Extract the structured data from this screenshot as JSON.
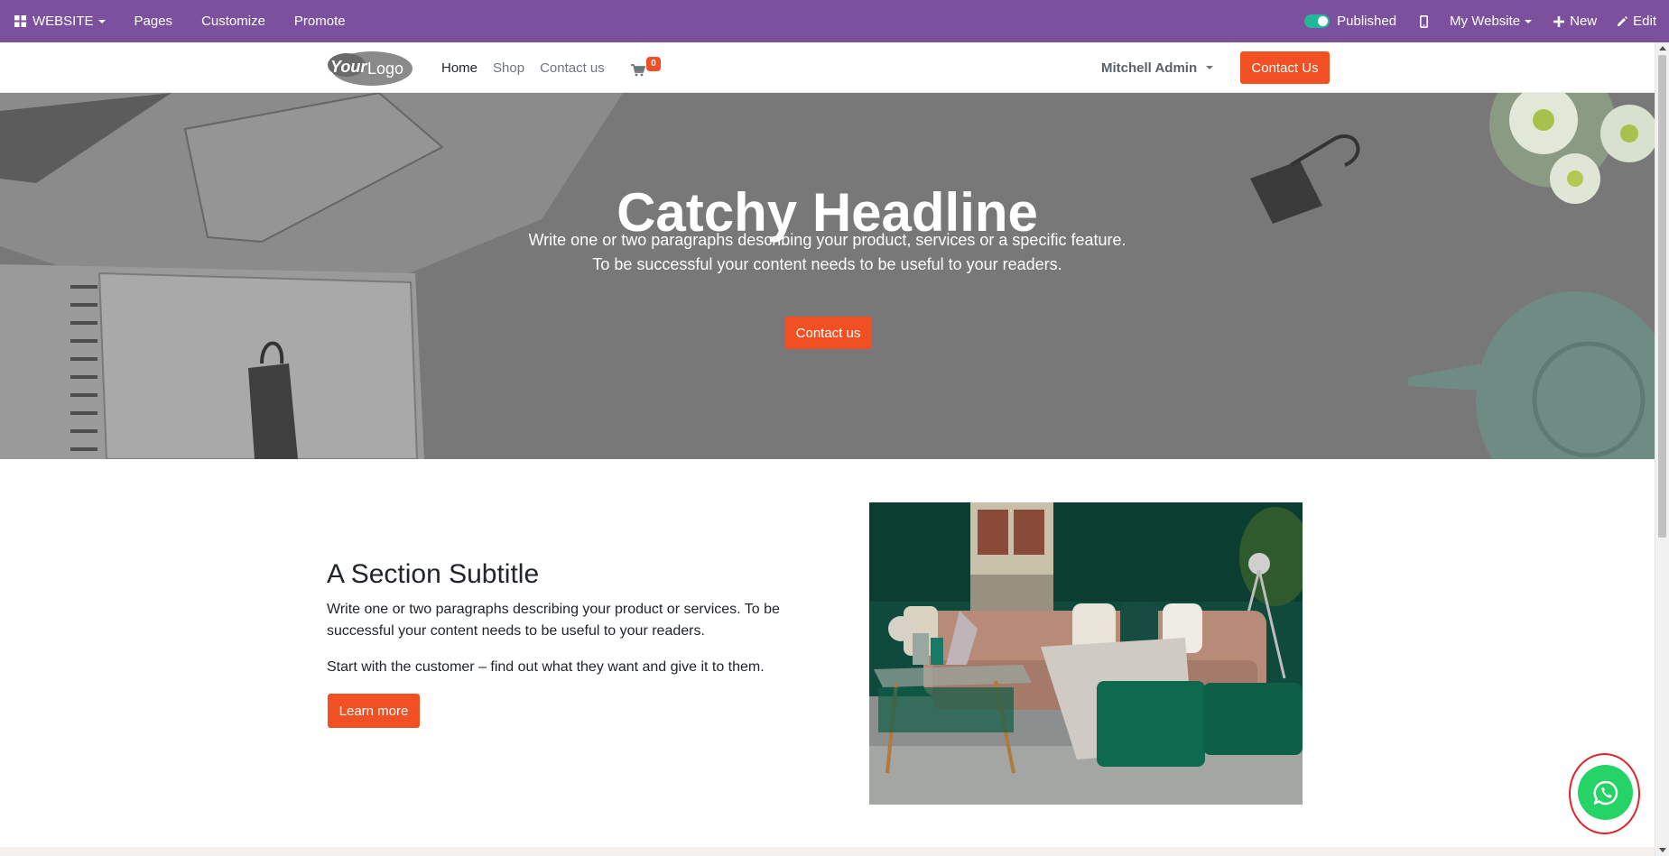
{
  "admin_bar": {
    "website_label": "WEBSITE",
    "pages": "Pages",
    "customize": "Customize",
    "promote": "Promote",
    "published": "Published",
    "my_website": "My Website",
    "new": "New",
    "edit": "Edit"
  },
  "navbar": {
    "logo_text": "YourLogo",
    "links": [
      "Home",
      "Shop",
      "Contact us"
    ],
    "active_link": "Home",
    "cart_count": "0",
    "user": "Mitchell Admin",
    "cta": "Contact Us"
  },
  "hero": {
    "title": "Catchy Headline",
    "line1": "Write one or two paragraphs describing your product, services or a specific feature.",
    "line2": "To be successful your content needs to be useful to your readers.",
    "button": "Contact us"
  },
  "section": {
    "subtitle": "A Section Subtitle",
    "paragraph1": "Write one or two paragraphs describing your product or services. To be successful your content needs to be useful to your readers.",
    "paragraph2": "Start with the customer – find out what they want and give it to them.",
    "button": "Learn more"
  },
  "colors": {
    "admin_bar": "#7b519d",
    "accent": "#f05023",
    "whatsapp": "#25d366",
    "highlight_ring": "#e0242b"
  },
  "icons": {
    "apps": "grid-icon",
    "mobile": "mobile-icon",
    "new": "plus-icon",
    "edit": "pencil-icon",
    "cart": "cart-icon",
    "whatsapp": "whatsapp-icon"
  }
}
